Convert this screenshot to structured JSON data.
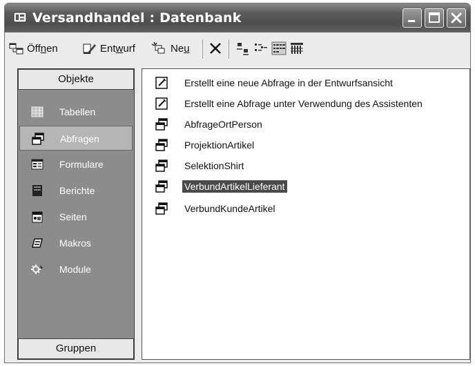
{
  "window": {
    "title": "Versandhandel : Datenbank"
  },
  "toolbar": {
    "open": {
      "pre": "Öff",
      "ul": "n",
      "post": "en"
    },
    "design": {
      "pre": "Ent",
      "ul": "w",
      "post": "urf"
    },
    "new": {
      "pre": "Ne",
      "ul": "u",
      "post": ""
    }
  },
  "sidebar": {
    "header": "Objekte",
    "footer": "Gruppen",
    "items": [
      {
        "label": "Tabellen",
        "icon": "table-icon"
      },
      {
        "label": "Abfragen",
        "icon": "query-icon",
        "active": true
      },
      {
        "label": "Formulare",
        "icon": "form-icon"
      },
      {
        "label": "Berichte",
        "icon": "report-icon"
      },
      {
        "label": "Seiten",
        "icon": "page-icon"
      },
      {
        "label": "Makros",
        "icon": "macro-icon"
      },
      {
        "label": "Module",
        "icon": "module-icon"
      }
    ]
  },
  "list": {
    "items": [
      {
        "label": "Erstellt eine neue Abfrage in der Entwurfsansicht",
        "icon": "wizard-icon"
      },
      {
        "label": "Erstellt eine Abfrage unter Verwendung des Assistenten",
        "icon": "wizard-icon"
      },
      {
        "label": "AbfrageOrtPerson",
        "icon": "query-icon"
      },
      {
        "label": "ProjektionArtikel",
        "icon": "query-icon"
      },
      {
        "label": "SelektionShirt",
        "icon": "query-icon"
      },
      {
        "label": "VerbundArtikelLieferant",
        "icon": "query-icon",
        "selected": true
      },
      {
        "label": "VerbundKundeArtikel",
        "icon": "query-icon"
      }
    ]
  }
}
